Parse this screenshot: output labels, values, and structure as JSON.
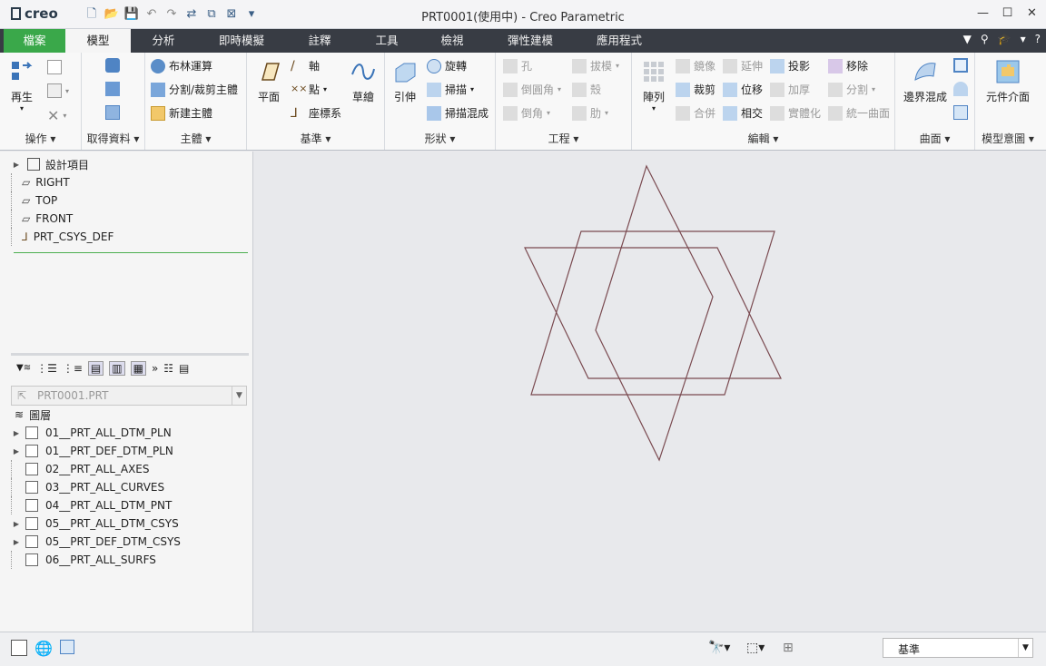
{
  "app": {
    "logo": "creo",
    "title": "PRT0001(使用中) - Creo Parametric"
  },
  "tabs": [
    "檔案",
    "模型",
    "分析",
    "即時模擬",
    "註釋",
    "工具",
    "檢視",
    "彈性建模",
    "應用程式"
  ],
  "ribbon": {
    "ops": {
      "regen": "再生",
      "label": "操作"
    },
    "getdata": {
      "label": "取得資料"
    },
    "body": {
      "boolean": "布林運算",
      "split": "分割/裁剪主體",
      "newbody": "新建主體",
      "label": "主體"
    },
    "datum": {
      "plane": "平面",
      "axis": "軸",
      "point": "點",
      "csys": "座標系",
      "sketch": "草繪",
      "label": "基準"
    },
    "shapes": {
      "extrude": "引伸",
      "revolve": "旋轉",
      "sweep": "掃描",
      "swept_blend": "掃描混成",
      "label": "形狀"
    },
    "engineering": {
      "hole": "孔",
      "draft": "拔模",
      "round": "倒圓角",
      "shell": "殼",
      "chamfer": "倒角",
      "rib": "肋",
      "label": "工程"
    },
    "editing": {
      "pattern": "陣列",
      "mirror": "鏡像",
      "extend": "延伸",
      "project": "投影",
      "remove": "移除",
      "trim": "裁剪",
      "offset": "位移",
      "thicken": "加厚",
      "split": "分割",
      "merge": "合併",
      "intersect": "相交",
      "solidify": "實體化",
      "unify": "統一曲面",
      "label": "編輯"
    },
    "surfaces": {
      "boundary": "邊界混成",
      "label": "曲面"
    },
    "intent": {
      "component": "元件介面",
      "label": "模型意圖"
    }
  },
  "model_tree": [
    "設計項目",
    "RIGHT",
    "TOP",
    "FRONT",
    "PRT_CSYS_DEF"
  ],
  "layers": {
    "model": "PRT0001.PRT",
    "root": "圖層",
    "items": [
      {
        "name": "01__PRT_ALL_DTM_PLN",
        "expandable": true
      },
      {
        "name": "01__PRT_DEF_DTM_PLN",
        "expandable": true
      },
      {
        "name": "02__PRT_ALL_AXES",
        "expandable": false
      },
      {
        "name": "03__PRT_ALL_CURVES",
        "expandable": false
      },
      {
        "name": "04__PRT_ALL_DTM_PNT",
        "expandable": false
      },
      {
        "name": "05__PRT_ALL_DTM_CSYS",
        "expandable": true
      },
      {
        "name": "05__PRT_DEF_DTM_CSYS",
        "expandable": true
      },
      {
        "name": "06__PRT_ALL_SURFS",
        "expandable": false
      }
    ]
  },
  "status": {
    "filter": "基準"
  },
  "colors": {
    "file_tab": "#3aa84a",
    "tabbar": "#383c44",
    "sketch": "#7a4a50"
  }
}
